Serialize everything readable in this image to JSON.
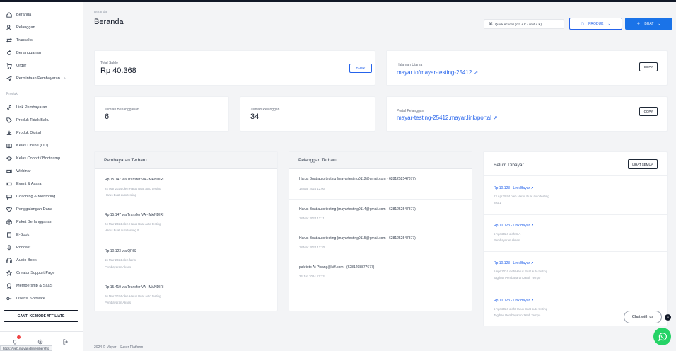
{
  "sidebar": {
    "items": [
      {
        "label": "Beranda",
        "icon": "home-icon"
      },
      {
        "label": "Pelanggan",
        "icon": "users-icon"
      },
      {
        "label": "Transaksi",
        "icon": "transfer-icon"
      },
      {
        "label": "Berlangganan",
        "icon": "refresh-icon"
      },
      {
        "label": "Order",
        "icon": "cart-icon"
      },
      {
        "label": "Permintaan Pembayaran",
        "icon": "send-icon"
      }
    ],
    "section_produk": "Produk",
    "produk_items": [
      {
        "label": "Link Pembayaran",
        "icon": "link-icon"
      },
      {
        "label": "Produk Tidak Baku",
        "icon": "tag-icon"
      },
      {
        "label": "Produk Digital",
        "icon": "download-icon"
      },
      {
        "label": "Kelas Online (OD)",
        "icon": "book-icon"
      },
      {
        "label": "Kelas Cohort / Bootcamp",
        "icon": "cap-icon"
      },
      {
        "label": "Webinar",
        "icon": "video-icon"
      },
      {
        "label": "Event & Acara",
        "icon": "ticket-icon"
      },
      {
        "label": "Coaching & Mentoring",
        "icon": "chat-icon"
      },
      {
        "label": "Penggalangan Dana",
        "icon": "heart-icon"
      },
      {
        "label": "Paket Berlangganan",
        "icon": "package-icon"
      },
      {
        "label": "E-Book",
        "icon": "ebook-icon"
      },
      {
        "label": "Podcast",
        "icon": "mic-icon"
      },
      {
        "label": "Audio Book",
        "icon": "headphones-icon"
      },
      {
        "label": "Creator Support Page",
        "icon": "star-icon"
      },
      {
        "label": "Membership & SaaS",
        "icon": "badge-icon"
      },
      {
        "label": "Lisensi Software",
        "icon": "key-icon"
      }
    ],
    "affiliate_button": "GANTI KE MODE AFFILIATE",
    "notif_count": "1",
    "url_tooltip": "https://web.mayar.id/membership"
  },
  "header": {
    "breadcrumb": "Beranda",
    "title": "Beranda",
    "shortcut": "Quick Actions (ctrl + K / cmd + K)",
    "produk_button": "PRODUK",
    "buat_button": "BUAT"
  },
  "stats": {
    "total_saldo_label": "Total Saldo",
    "total_saldo_value": "Rp 40.368",
    "tarik_label": "TARIK",
    "halaman_label": "Halaman Utama",
    "halaman_link": "mayar.to/mayar-testing-25412 ↗",
    "copy_label": "COPY",
    "berlangganan_label": "Jumlah Berlangganan",
    "berlangganan_value": "6",
    "pelanggan_label": "Jumlah Pelanggan",
    "pelanggan_value": "34",
    "portal_label": "Portal Pelanggan",
    "portal_link": "mayar-testing-25412.mayar.link/portal ↗",
    "copy2_label": "COPY"
  },
  "pembayaran": {
    "title": "Pembayaran Terbaru",
    "items": [
      {
        "title": "Rp 15.147 via Transfer VA - MANDIRI",
        "sub1": "24 Mar 2024 oleh Harus Buat auto testing",
        "sub2": "Harus Buat auto testing"
      },
      {
        "title": "Rp 15.147 via Transfer VA - MANDIRI",
        "sub1": "24 Mar 2024 oleh Harus Buat auto testing",
        "sub2": "Harus Buat auto testing 9"
      },
      {
        "title": "Rp 10.123 via QRIS",
        "sub1": "16 Mar 2024 oleh fajrito",
        "sub2": "Pembayaran Akses"
      },
      {
        "title": "Rp 15.419 via Transfer VA - MANDIRI",
        "sub1": "16 Mar 2024 oleh Harus Buat auto testing",
        "sub2": "Pembayaran Akses"
      }
    ]
  },
  "pelanggan": {
    "title": "Pelanggan Terbaru",
    "items": [
      {
        "title": "Harus Buat auto testing (mayartesting0112@gmail.com - 6281252547877)",
        "sub": "18 Mar 2024 12:00"
      },
      {
        "title": "Harus Buat auto testing (mayartesting0114@gmail.com - 6281252547877)",
        "sub": "18 Mar 2024 12:11"
      },
      {
        "title": "Harus Buat auto testing (mayartesting0115@gmail.com - 6281252547877)",
        "sub": "18 Mar 2024 12:20"
      },
      {
        "title": "pak toto At Pisang@kiff.com - (6281298877677)",
        "sub": "24 Jun 2024 13:13"
      }
    ]
  },
  "belum": {
    "title": "Belum Dibayar",
    "button": "LIHAT SEMUA",
    "items": [
      {
        "link": "Rp 10.123 - Link Bayar ↗",
        "sub1": "13 Apr 2024 oleh Harus Buat auto testing",
        "sub2": "test 1"
      },
      {
        "link": "Rp 10.123 - Link Bayar ↗",
        "sub1": "5 Apr 2024 oleh SIA",
        "sub2": "Pembayaran Akses"
      },
      {
        "link": "Rp 10.123 - Link Bayar ↗",
        "sub1": "5 Apr 2024 oleh Harus Buat auto testing",
        "sub2": "Tagihan Pembayaran Jatuh Tempo"
      },
      {
        "link": "Rp 10.123 - Link Bayar ↗",
        "sub1": "5 Apr 2024 oleh Harus Buat auto testing",
        "sub2": "Tagihan Pembayaran Jatuh Tempo"
      }
    ]
  },
  "footer": "2024 © Mayar - Super Platform",
  "chat_label": "Chat with us",
  "colors": {
    "primary": "#1a73e8",
    "link": "#2563eb",
    "whatsapp": "#25d366"
  }
}
